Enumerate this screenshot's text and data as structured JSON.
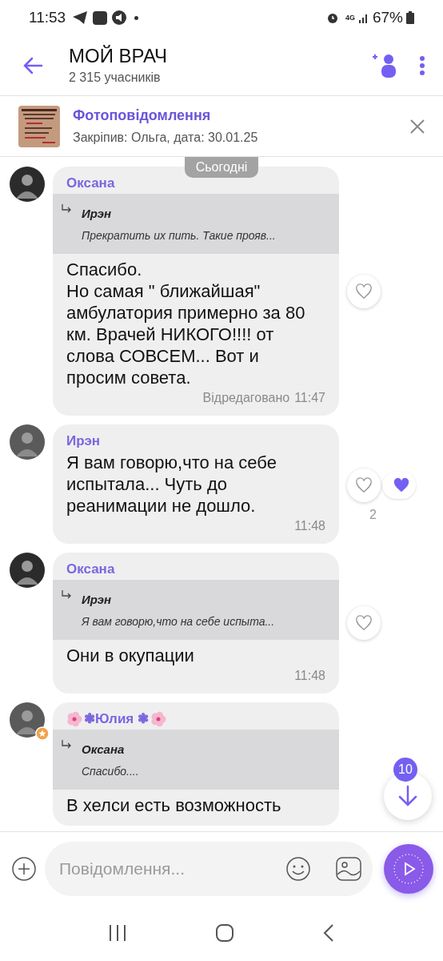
{
  "status_bar": {
    "time": "11:53",
    "network": "4G",
    "battery": "67%"
  },
  "header": {
    "title": "МОЙ ВРАЧ",
    "subtitle": "2 315 учасників"
  },
  "pinned": {
    "title": "Фотоповідомлення",
    "subtitle": "Закріпив: Ольга, дата: 30.01.25"
  },
  "date_chip": "Сьогодні",
  "messages": [
    {
      "author": "Оксана",
      "admin": false,
      "decorated": false,
      "quote": {
        "author": "Ирэн",
        "text": "Прекратить их пить. Такие прояв..."
      },
      "text": "Спасибо.\nНо самая \" ближайшая\" амбулатория примерно за 80 км. Врачей НИКОГО!!!! от слова СОВСЕМ... Вот и просим совета.",
      "edited": "Відредаговано",
      "time": "11:47",
      "liked": false
    },
    {
      "author": "Ирэн",
      "admin": false,
      "decorated": false,
      "text": "Я вам говорю,что на себе испытала... Чуть до реанимации не дошло.",
      "time": "11:48",
      "liked": true,
      "like_count": "2"
    },
    {
      "author": "Оксана",
      "admin": false,
      "decorated": false,
      "quote": {
        "author": "Ирэн",
        "text": "Я вам говорю,что на себе испыта..."
      },
      "text": "Они в окупации",
      "time": "11:48",
      "liked": false
    },
    {
      "author": "❃Юлия ❃",
      "admin": true,
      "decorated": true,
      "quote": {
        "author": "Оксана",
        "text": "Спасибо...."
      },
      "text": "В хелси есть возможность"
    }
  ],
  "scroll_button": {
    "badge": "10"
  },
  "composer": {
    "placeholder": "Повідомлення..."
  }
}
